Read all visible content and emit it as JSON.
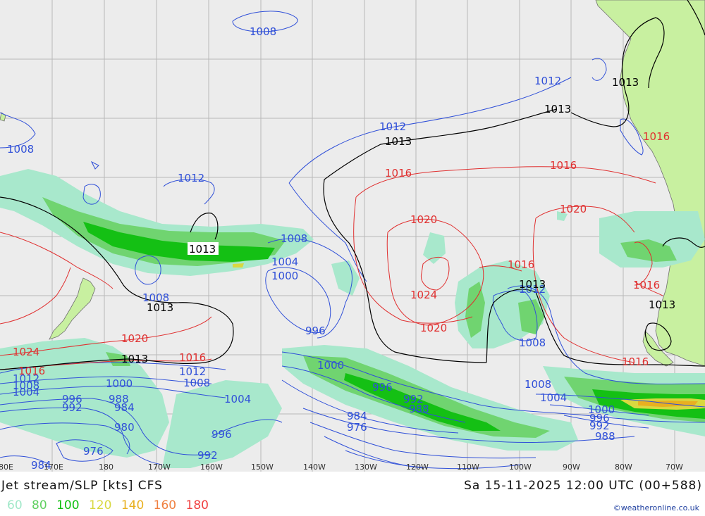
{
  "map": {
    "title": "Jet stream/SLP [kts] CFS",
    "valid_time": "Sa 15-11-2025 12:00 UTC (00+588)",
    "credit": "©weatheronline.co.uk",
    "longitude_ticks": [
      "80E",
      "170E",
      "180",
      "170W",
      "160W",
      "150W",
      "140W",
      "130W",
      "120W",
      "110W",
      "100W",
      "90W",
      "80W",
      "70W"
    ],
    "legend": [
      {
        "label": "60",
        "color": "#a0e8c8"
      },
      {
        "label": "80",
        "color": "#60d060"
      },
      {
        "label": "100",
        "color": "#10c010"
      },
      {
        "label": "120",
        "color": "#d8d840"
      },
      {
        "label": "140",
        "color": "#e8b020"
      },
      {
        "label": "160",
        "color": "#f08040"
      },
      {
        "label": "180",
        "color": "#f04040"
      }
    ],
    "isobar_labels": {
      "l1008a": "1008",
      "l1012a": "1012",
      "l1012b": "1012",
      "l1008b": "1008",
      "l1012c": "1012",
      "l1013a": "1013",
      "l1013b": "1013",
      "l1013c": "1013",
      "l1013d": "1013",
      "l1013e": "1013",
      "l1016a": "1016",
      "l1016b": "1016",
      "l1016c": "1016",
      "l1016d": "1016",
      "l1016e": "1016",
      "l1016f": "1016",
      "l1016g": "1016",
      "l1020a": "1020",
      "l1020b": "1020",
      "l1020c": "1020",
      "l1020d": "1020",
      "l1024a": "1024",
      "l1024b": "1024",
      "l1008c": "1008",
      "l1008d": "1008",
      "l1008e": "1008",
      "l1008f": "1008",
      "l1008g": "1008",
      "l1008h": "1008",
      "l1004a": "1004",
      "l1004b": "1004",
      "l1004c": "1004",
      "l1004d": "1004",
      "l1000a": "1000",
      "l1000b": "1000",
      "l1000c": "1000",
      "l1000d": "1000",
      "l996a": "996",
      "l996b": "996",
      "l996c": "996",
      "l996d": "996",
      "l996e": "996",
      "l992a": "992",
      "l992b": "992",
      "l992c": "992",
      "l992d": "992",
      "l988a": "988",
      "l988b": "988",
      "l988c": "988",
      "l984a": "984",
      "l984b": "984",
      "l984c": "984",
      "l980": "980",
      "l976a": "976",
      "l976b": "976",
      "l1012d": "1012",
      "l1012e": "1012",
      "l1012f": "1012"
    }
  }
}
